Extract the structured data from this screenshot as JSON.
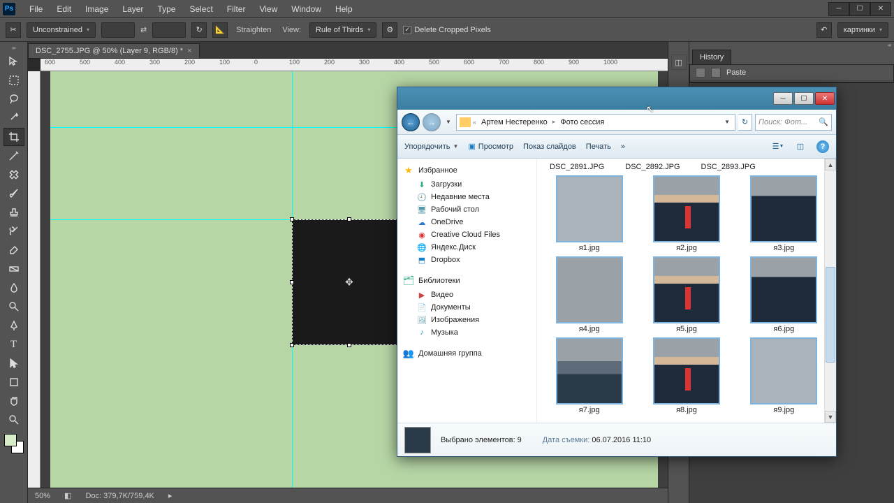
{
  "menubar": {
    "items": [
      "File",
      "Edit",
      "Image",
      "Layer",
      "Type",
      "Select",
      "Filter",
      "View",
      "Window",
      "Help"
    ]
  },
  "options": {
    "ratio": "Unconstrained",
    "straighten": "Straighten",
    "view_label": "View:",
    "view_value": "Rule of Thirds",
    "delete_cropped": "Delete Cropped Pixels",
    "workspace": "картинки"
  },
  "doc": {
    "tab": "DSC_2755.JPG @ 50% (Layer 9, RGB/8) *"
  },
  "status": {
    "zoom": "50%",
    "doc_size": "Doc: 379,7K/759,4K"
  },
  "ruler_ticks": [
    "600",
    "500",
    "400",
    "300",
    "200",
    "100",
    "0",
    "100",
    "200",
    "300",
    "400",
    "500",
    "600",
    "700",
    "800",
    "900",
    "1000"
  ],
  "history": {
    "tab": "History",
    "entry": "Paste"
  },
  "explorer": {
    "breadcrumb": {
      "sep": "«",
      "seg1": "Артем Нестеренко",
      "seg2": "Фото сессия"
    },
    "search_placeholder": "Поиск: Фот...",
    "toolbar": {
      "organize": "Упорядочить",
      "preview": "Просмотр",
      "slideshow": "Показ слайдов",
      "print": "Печать"
    },
    "tree": {
      "favorites": "Избранное",
      "fav_items": [
        {
          "icon": "⬇",
          "label": "Загрузки",
          "color": "#3a8"
        },
        {
          "icon": "🕘",
          "label": "Недавние места",
          "color": "#59a"
        },
        {
          "icon": "🖥",
          "label": "Рабочий стол",
          "color": "#59a"
        },
        {
          "icon": "☁",
          "label": "OneDrive",
          "color": "#2a7bd1"
        },
        {
          "icon": "◉",
          "label": "Creative Cloud Files",
          "color": "#d33"
        },
        {
          "icon": "🌐",
          "label": "Яндекс.Диск",
          "color": "#f0c000"
        },
        {
          "icon": "⬒",
          "label": "Dropbox",
          "color": "#1a7ec5"
        }
      ],
      "libraries": "Библиотеки",
      "lib_items": [
        {
          "icon": "▶",
          "label": "Видео",
          "color": "#c44"
        },
        {
          "icon": "📄",
          "label": "Документы",
          "color": "#8a6"
        },
        {
          "icon": "🖼",
          "label": "Изображения",
          "color": "#59a"
        },
        {
          "icon": "♪",
          "label": "Музыка",
          "color": "#39c"
        }
      ],
      "homegroup": "Домашняя группа"
    },
    "top_labels": [
      "DSC_2891.JPG",
      "DSC_2892.JPG",
      "DSC_2893.JPG"
    ],
    "thumbs": [
      "я1.jpg",
      "я2.jpg",
      "я3.jpg",
      "я4.jpg",
      "я5.jpg",
      "я6.jpg",
      "я7.jpg",
      "я8.jpg",
      "я9.jpg"
    ],
    "details": {
      "selected": "Выбрано элементов: 9",
      "date_label": "Дата съемки:",
      "date_value": "06.07.2016 11:10"
    }
  }
}
